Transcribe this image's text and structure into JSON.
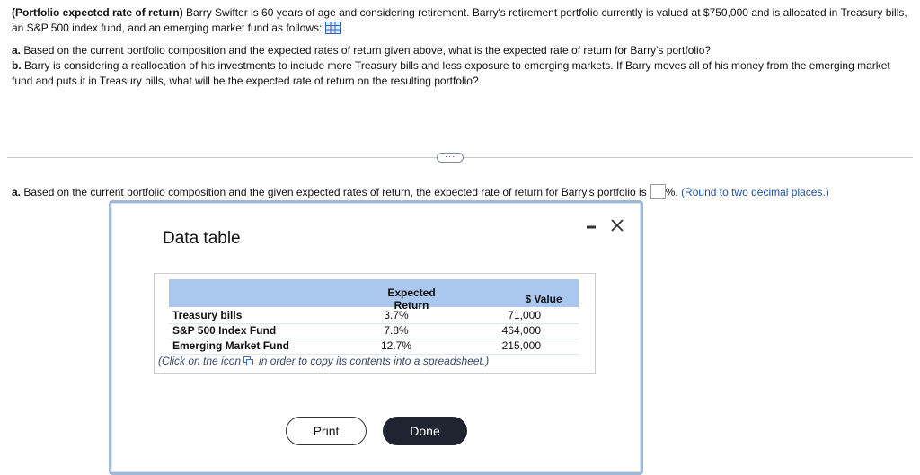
{
  "problem": {
    "title": "(Portfolio expected rate of return)",
    "intro": " Barry Swifter is 60 years of age and considering retirement. Barry's retirement portfolio currently is valued at $750,000 and is allocated in Treasury bills, an S&P 500 index fund, and an emerging market fund as follows:",
    "intro_end": ".",
    "part_a_label": "a.",
    "part_a_text": " Based on the current portfolio composition and the expected rates of return given above, what is the expected rate of return for Barry's portfolio?",
    "part_b_label": "b.",
    "part_b_text": " Barry is considering a reallocation of his investments to include more Treasury bills and less exposure to emerging markets. If Barry moves all of his money from the emerging market fund and puts it in Treasury bills, what will be the expected rate of return on the resulting portfolio?"
  },
  "more_button": "···",
  "answer": {
    "label": "a.",
    "text": " Based on the current portfolio composition and the given expected rates of return, the expected rate of return for Barry's portfolio is",
    "unit": "%.",
    "hint": "(Round to two decimal places.)"
  },
  "dialog": {
    "title": "Data table",
    "minimize_glyph": "–",
    "close_glyph": "✕",
    "table": {
      "header_return_line1": "Expected",
      "header_return_line2": "Return",
      "header_value": "$ Value",
      "rows": [
        {
          "name": "Treasury bills",
          "return": "3.7%",
          "value": "71,000"
        },
        {
          "name": "S&P 500 Index Fund",
          "return": "7.8%",
          "value": "464,000"
        },
        {
          "name": "Emerging Market Fund",
          "return": "12.7%",
          "value": "215,000"
        }
      ]
    },
    "note_before": "(Click on the icon",
    "note_after": "in order to copy its contents into a spreadsheet.)",
    "print_label": "Print",
    "done_label": "Done"
  },
  "colors": {
    "header_band": "#a9c7ef",
    "dialog_border": "#9fb9db",
    "hint_text": "#1f4fa8",
    "done_button": "#1f2430"
  }
}
